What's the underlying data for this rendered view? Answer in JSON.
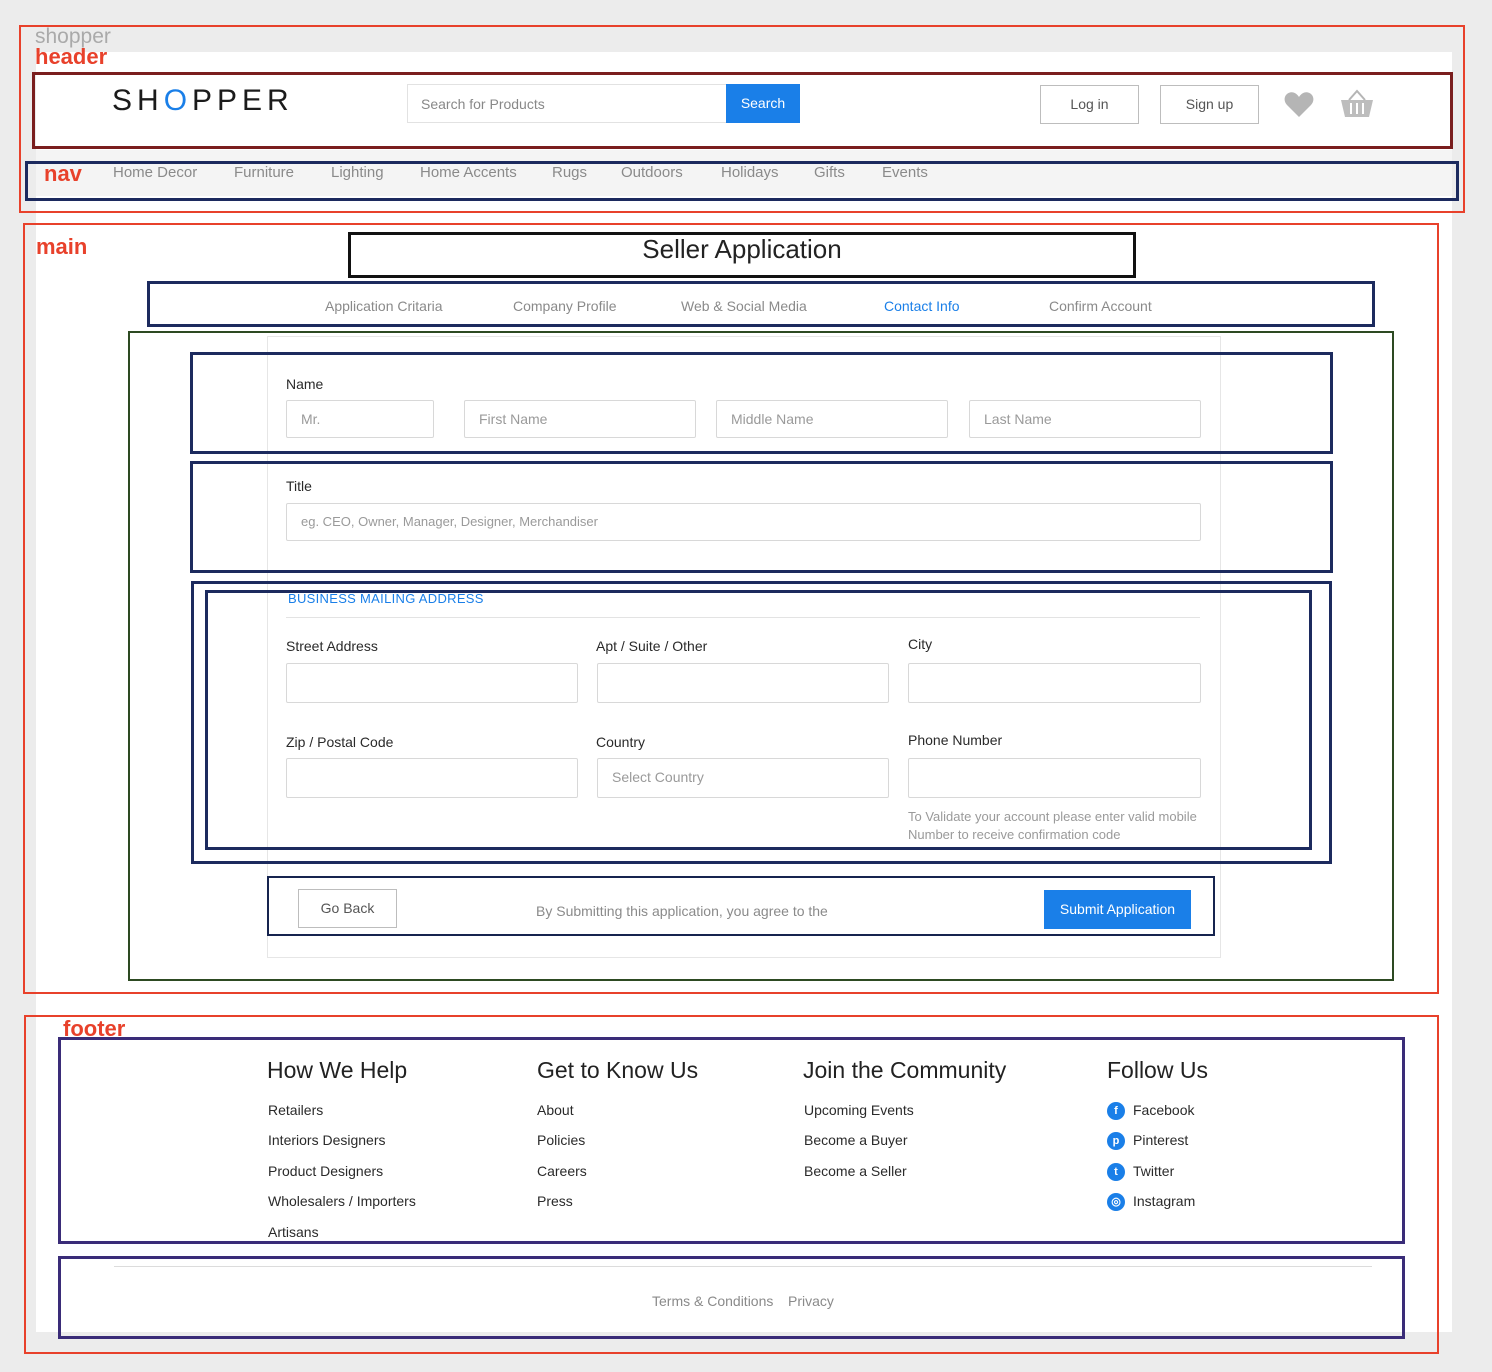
{
  "annotations": {
    "shopper": "shopper",
    "header": "header",
    "nav": "nav",
    "main": "main",
    "footer": "footer"
  },
  "header": {
    "logo_pre": "SH",
    "logo_o": "O",
    "logo_post": "PPER",
    "search_placeholder": "Search for Products",
    "search_button": "Search",
    "login": "Log in",
    "signup": "Sign up"
  },
  "nav": {
    "items": [
      "Home Decor",
      "Furniture",
      "Lighting",
      "Home Accents",
      "Rugs",
      "Outdoors",
      "Holidays",
      "Gifts",
      "Events"
    ]
  },
  "main": {
    "title": "Seller Application",
    "steps": [
      "Application Critaria",
      "Company Profile",
      "Web & Social Media",
      "Contact Info",
      "Confirm Account"
    ],
    "active_step": "Contact Info",
    "name_label": "Name",
    "name_fields": {
      "prefix": "Mr.",
      "first": "First Name",
      "middle": "Middle Name",
      "last": "Last Name"
    },
    "title_label": "Title",
    "title_placeholder": "eg. CEO, Owner, Manager, Designer, Merchandiser",
    "address_section": "BUSINESS MAILING ADDRESS",
    "street_label": "Street Address",
    "apt_label": "Apt / Suite / Other",
    "city_label": "City",
    "zip_label": "Zip / Postal Code",
    "country_label": "Country",
    "country_placeholder": "Select Country",
    "phone_label": "Phone Number",
    "phone_hint": "To Validate your account please enter valid mobile Number to receive confirmation code",
    "go_back": "Go Back",
    "agree_text": "By Submitting this application, you agree to the",
    "submit": "Submit Application"
  },
  "footer": {
    "columns": [
      {
        "heading": "How We Help",
        "links": [
          "Retailers",
          "Interiors Designers",
          "Product Designers",
          "Wholesalers / Importers",
          "Artisans"
        ]
      },
      {
        "heading": "Get to Know Us",
        "links": [
          "About",
          "Policies",
          "Careers",
          "Press"
        ]
      },
      {
        "heading": "Join the Community",
        "links": [
          "Upcoming Events",
          "Become a Buyer",
          "Become a Seller"
        ]
      },
      {
        "heading": "Follow Us",
        "links": [
          "Facebook",
          "Pinterest",
          "Twitter",
          "Instagram"
        ]
      }
    ],
    "social_icons": [
      "facebook-icon",
      "pinterest-icon",
      "twitter-icon",
      "instagram-icon"
    ],
    "terms": "Terms & Conditions",
    "privacy": "Privacy"
  },
  "colors": {
    "accent": "#1a7fe8",
    "annotation_red": "#e8412b"
  }
}
